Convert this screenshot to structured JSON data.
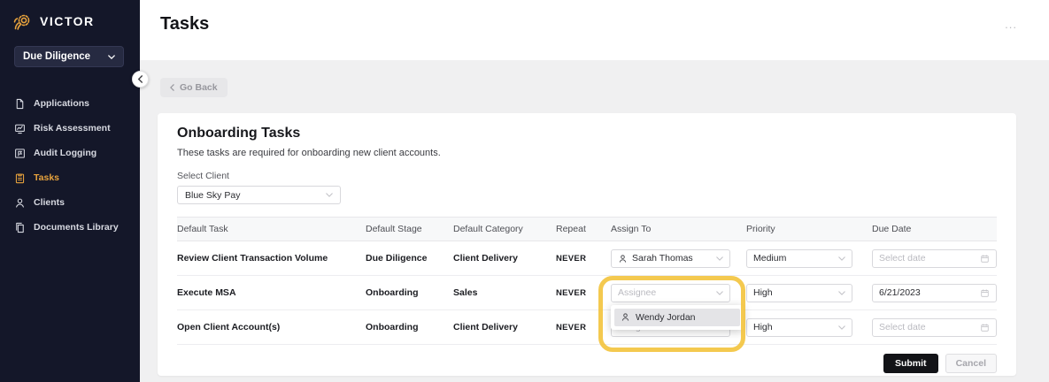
{
  "brand": {
    "name": "VICTOR"
  },
  "sidebar": {
    "workspace": "Due Diligence",
    "items": [
      {
        "label": "Applications"
      },
      {
        "label": "Risk Assessment"
      },
      {
        "label": "Audit Logging"
      },
      {
        "label": "Tasks"
      },
      {
        "label": "Clients"
      },
      {
        "label": "Documents Library"
      }
    ]
  },
  "header": {
    "title": "Tasks",
    "overflow": "..."
  },
  "toolbar": {
    "go_back": "Go Back"
  },
  "panel": {
    "title": "Onboarding Tasks",
    "subtitle": "These tasks are required for onboarding new client accounts.",
    "client": {
      "label": "Select Client",
      "value": "Blue Sky Pay"
    }
  },
  "table": {
    "headers": [
      "Default Task",
      "Default Stage",
      "Default Category",
      "Repeat",
      "Assign To",
      "Priority",
      "Due Date"
    ],
    "rows": [
      {
        "task": "Review Client Transaction Volume",
        "stage": "Due Diligence",
        "category": "Client Delivery",
        "repeat": "NEVER",
        "assignee": "Sarah Thomas",
        "priority": "Medium",
        "due_placeholder": "Select date"
      },
      {
        "task": "Execute MSA",
        "stage": "Onboarding",
        "category": "Sales",
        "repeat": "NEVER",
        "assignee_placeholder": "Assignee",
        "priority": "High",
        "due": "6/21/2023"
      },
      {
        "task": "Open Client Account(s)",
        "stage": "Onboarding",
        "category": "Client Delivery",
        "repeat": "NEVER",
        "assignee_placeholder": "Assignee",
        "priority": "High",
        "due_placeholder": "Select date"
      }
    ]
  },
  "assignee_dropdown": {
    "options": [
      "Wendy Jordan"
    ]
  },
  "actions": {
    "submit": "Submit",
    "cancel": "Cancel"
  },
  "colors": {
    "accent": "#E8A33D",
    "highlight": "#F2C137",
    "sidebar_bg": "#141729"
  }
}
